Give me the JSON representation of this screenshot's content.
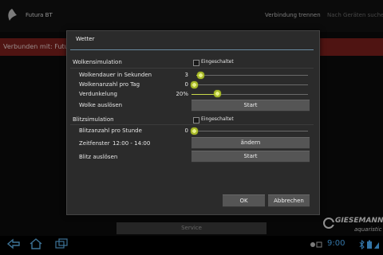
{
  "topbar": {
    "app_title": "Futura BT",
    "disconnect": "Verbindung trennen",
    "search": "Nach Geräten suchen"
  },
  "banner": {
    "text": "Verbunden mit: Futur"
  },
  "service": {
    "label": "Service"
  },
  "brand": {
    "name": "GIESEMANN",
    "sub": "aquaristic"
  },
  "clock": "9:00",
  "dialog": {
    "title": "Wetter",
    "clouds": {
      "section_label": "Wolkensimulation",
      "enabled_label": "Eingeschaltet",
      "duration_label": "Wolkendauer in Sekunden",
      "duration_value": "3",
      "per_day_label": "Wolkenanzahl pro Tag",
      "per_day_value": "0",
      "dimming_label": "Verdunkelung",
      "dimming_value": "20%",
      "trigger_label": "Wolke auslösen",
      "trigger_button": "Start"
    },
    "lightning": {
      "section_label": "Blitzsimulation",
      "enabled_label": "Eingeschaltet",
      "per_hour_label": "Blitzanzahl pro Stunde",
      "per_hour_value": "0",
      "window_label": "Zeitfenster",
      "window_value": "12:00 - 14:00",
      "change_button": "ändern",
      "trigger_label": "Blitz auslösen",
      "trigger_button": "Start"
    },
    "ok": "OK",
    "cancel": "Abbrechen"
  }
}
